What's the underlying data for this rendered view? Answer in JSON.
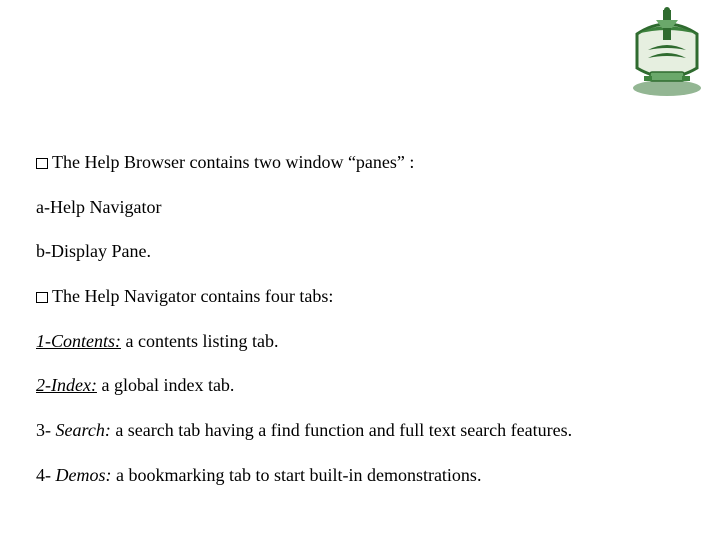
{
  "lines": {
    "l1_a": "The Help Browser contains two window “panes” :",
    "l2": "a-Help Navigator",
    "l3": "b-Display Pane.",
    "l4_a": "The Help Navigator contains four tabs:",
    "l5_pre": "1-Contents:",
    "l5_post": " a contents listing tab.",
    "l6_pre": "2-Index:",
    "l6_post": " a global index tab.",
    "l7_pre": "3- ",
    "l7_mid": "Search:",
    "l7_post": " a search tab having a find function and full text search features.",
    "l8_pre": "4- ",
    "l8_mid": "Demos:",
    "l8_post": " a bookmarking tab to start built-in demonstrations."
  }
}
